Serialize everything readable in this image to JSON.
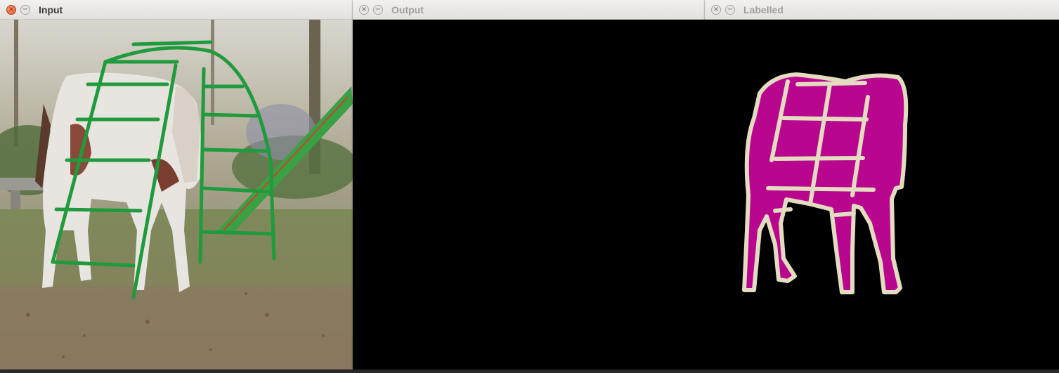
{
  "windows": {
    "input": {
      "title": "Input"
    },
    "output": {
      "title": "Output"
    },
    "labelled": {
      "title": "Labelled"
    }
  },
  "icons": {
    "close": "close-icon",
    "minimize": "minimize-icon"
  },
  "colors": {
    "label_fill": "#b8078e",
    "label_outline": "#e4dcc0",
    "background": "#000000"
  },
  "buttons": {
    "close_glyph": "×",
    "min_glyph": "−"
  }
}
